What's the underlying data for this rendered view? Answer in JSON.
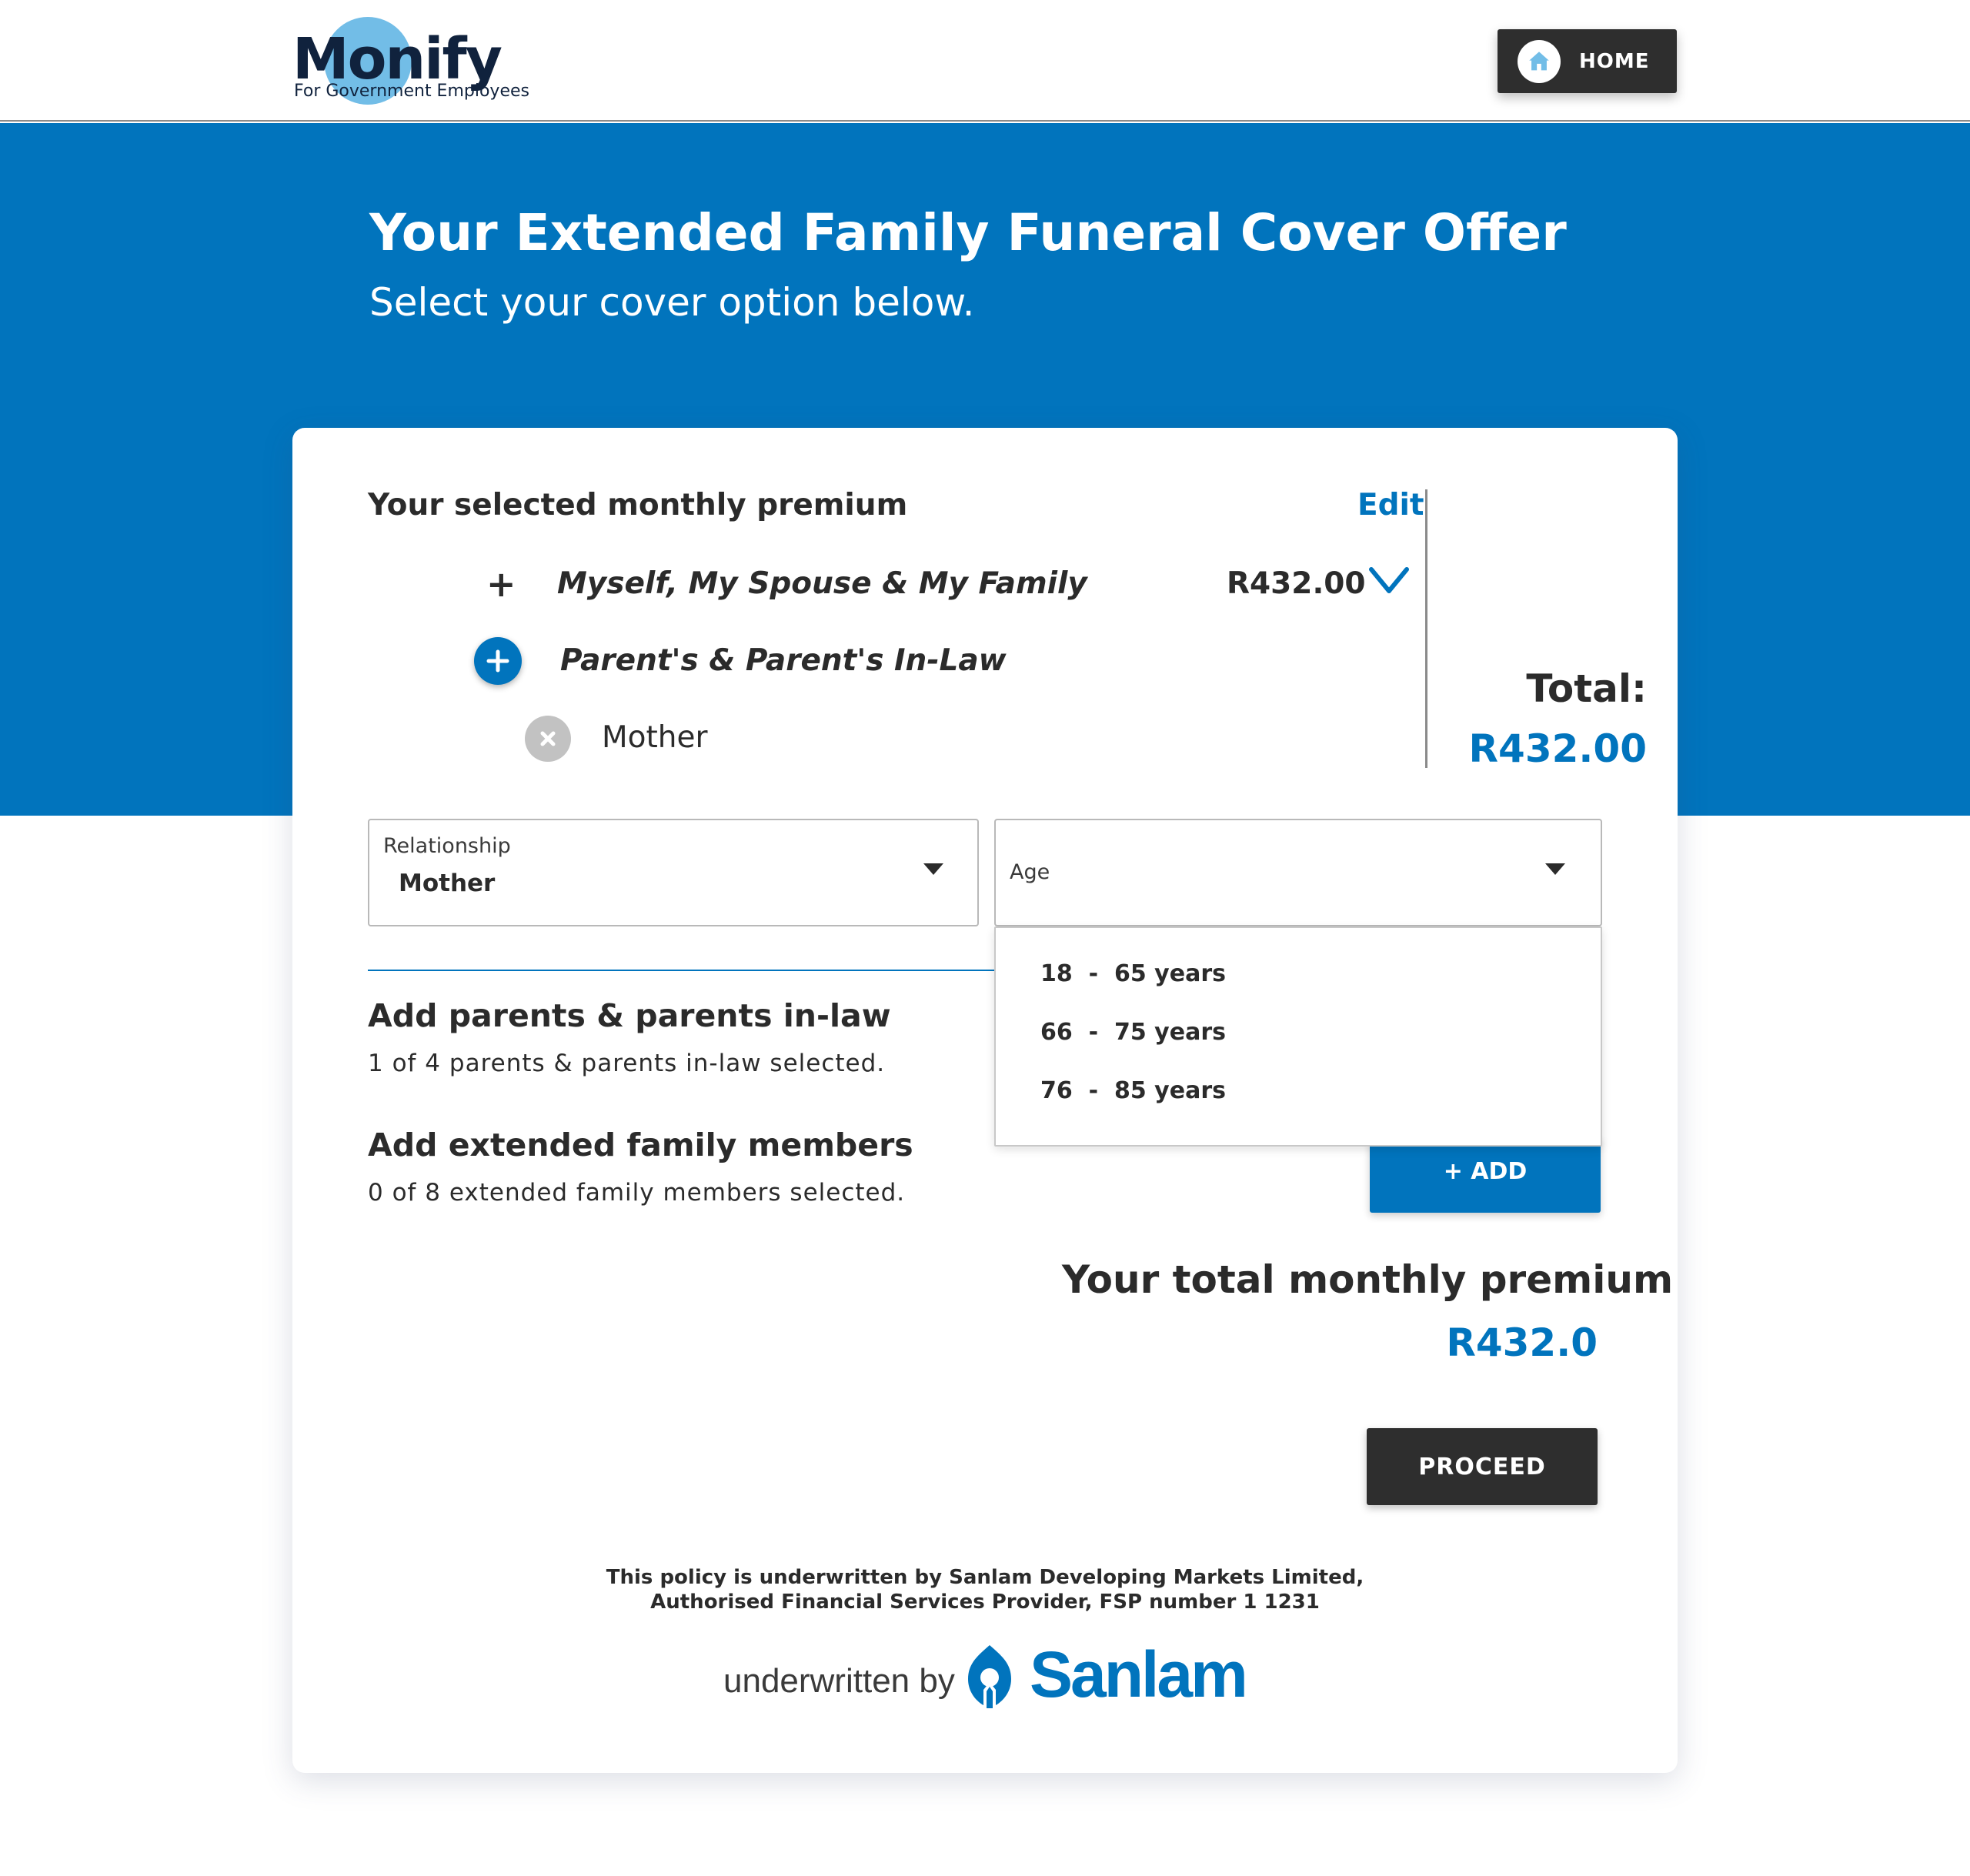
{
  "header": {
    "logo_text": "Monify",
    "logo_subtitle": "For Government Employees",
    "home_label": "HOME"
  },
  "hero": {
    "title": "Your Extended Family Funeral Cover Offer",
    "subtitle": "Select your cover option below."
  },
  "premium": {
    "title": "Your selected monthly premium",
    "edit_label": "Edit",
    "rows": [
      {
        "label": "Myself, My Spouse & My Family",
        "price": "R432.00"
      },
      {
        "label": "Parent's & Parent's In-Law"
      },
      {
        "label": "Mother"
      }
    ],
    "total_label": "Total:",
    "total_value": "R432.00"
  },
  "form": {
    "relationship_label": "Relationship",
    "relationship_value": "Mother",
    "age_label": "Age",
    "age_options": [
      "18  -  65 years",
      "66  -  75 years",
      "76  -  85 years"
    ],
    "add_label": "+ ADD"
  },
  "sections": {
    "parents_title": "Add parents & parents in-law",
    "parents_sub": "1 of 4 parents & parents in-law selected.",
    "extended_title": "Add extended family members",
    "extended_sub": "0 of 8 extended family members selected."
  },
  "total": {
    "title": "Your total monthly premium",
    "value": "R432.0"
  },
  "proceed_label": "PROCEED",
  "footer": {
    "disclaimer_line1": "This policy is underwritten by Sanlam Developing Markets Limited,",
    "disclaimer_line2": "Authorised Financial Services Provider, FSP number 1 1231",
    "underwritten_by": "underwritten by",
    "sanlam": "Sanlam"
  },
  "colors": {
    "brand_blue": "#0174bd",
    "dark_button": "#2e2e2e",
    "logo_circle": "#72bde7",
    "remove_grey": "#c2c2c2"
  },
  "icons": [
    "home-icon",
    "plus-icon",
    "plus-circle-icon",
    "chevron-down-icon",
    "close-circle-icon",
    "caret-down-icon",
    "sanlam-logo-icon"
  ]
}
